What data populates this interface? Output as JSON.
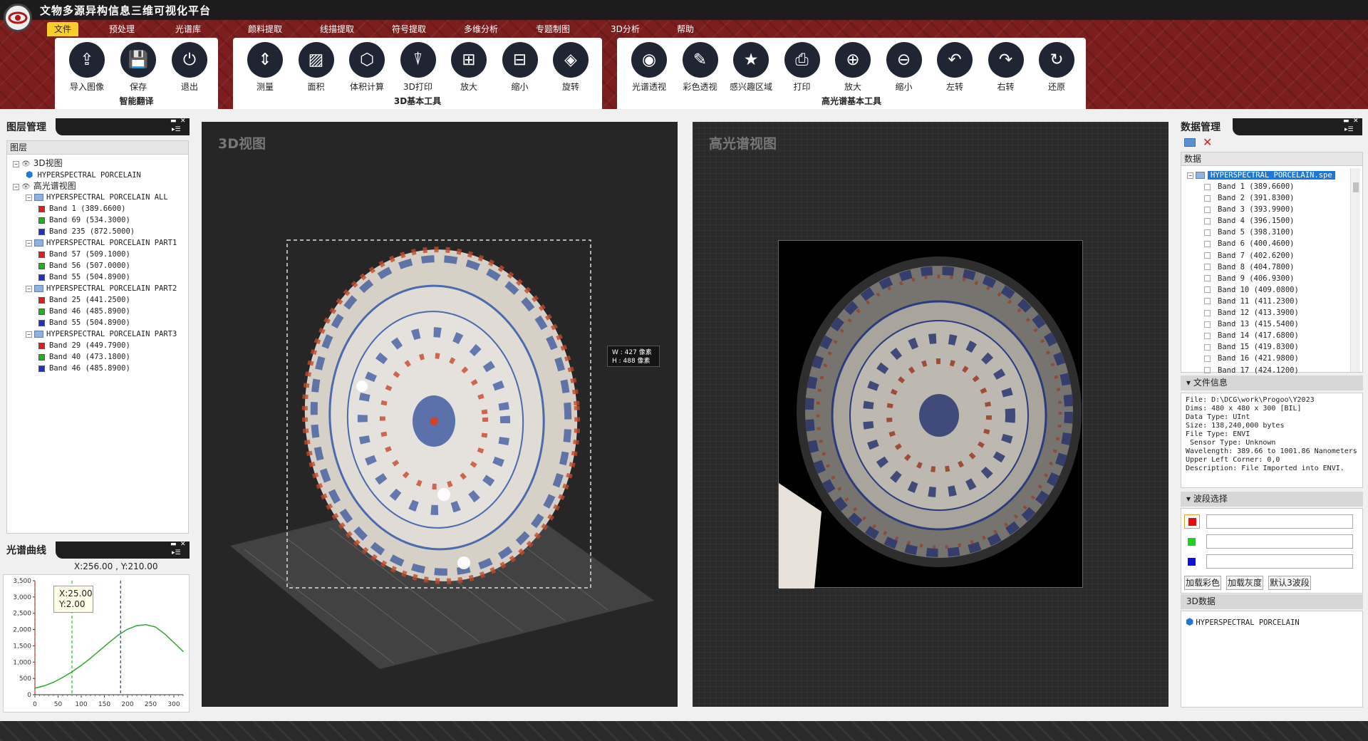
{
  "app": {
    "title": "文物多源异构信息三维可视化平台"
  },
  "tabs": [
    "文件",
    "预处理",
    "光谱库",
    "颜料提取",
    "线描提取",
    "符号提取",
    "多维分析",
    "专题制图",
    "3D分析",
    "帮助"
  ],
  "groups": {
    "smart": {
      "title": "智能翻译",
      "tools": [
        {
          "label": "导入图像",
          "icon": "import-icon",
          "glyph": "⇪"
        },
        {
          "label": "保存",
          "icon": "save-icon",
          "glyph": "💾"
        },
        {
          "label": "退出",
          "icon": "power-icon",
          "glyph": "⏻"
        }
      ]
    },
    "basic3d": {
      "title": "3D基本工具",
      "tools": [
        {
          "label": "测量",
          "icon": "measure-icon",
          "glyph": "⇕"
        },
        {
          "label": "面积",
          "icon": "area-icon",
          "glyph": "▨"
        },
        {
          "label": "体积计算",
          "icon": "volume-icon",
          "glyph": "⬡"
        },
        {
          "label": "3D打印",
          "icon": "print3d-icon",
          "glyph": "⍒"
        },
        {
          "label": "放大",
          "icon": "zoom-in-icon",
          "glyph": "⊞"
        },
        {
          "label": "缩小",
          "icon": "zoom-out-icon",
          "glyph": "⊟"
        },
        {
          "label": "旋转",
          "icon": "rotate3d-icon",
          "glyph": "◈"
        }
      ]
    },
    "hyper": {
      "title": "高光谱基本工具",
      "tools": [
        {
          "label": "光谱透视",
          "icon": "spectral-icon",
          "glyph": "◉"
        },
        {
          "label": "彩色透视",
          "icon": "color-icon",
          "glyph": "✎"
        },
        {
          "label": "感兴趣区域",
          "icon": "roi-icon",
          "glyph": "★"
        },
        {
          "label": "打印",
          "icon": "printer-icon",
          "glyph": "⎙"
        },
        {
          "label": "放大",
          "icon": "zoom-in-icon",
          "glyph": "⊕"
        },
        {
          "label": "缩小",
          "icon": "zoom-out-icon",
          "glyph": "⊖"
        },
        {
          "label": "左转",
          "icon": "undo-icon",
          "glyph": "↶"
        },
        {
          "label": "右转",
          "icon": "redo-icon",
          "glyph": "↷"
        },
        {
          "label": "还原",
          "icon": "reset-icon",
          "glyph": "↻"
        }
      ]
    }
  },
  "layers": {
    "title": "图层管理",
    "header": "图层",
    "items": [
      {
        "type": "group",
        "label": "3D视图",
        "indent": 0
      },
      {
        "type": "cube",
        "label": "HYPERSPECTRAL PORCELAIN",
        "indent": 1
      },
      {
        "type": "group",
        "label": "高光谱视图",
        "indent": 0
      },
      {
        "type": "file",
        "label": "HYPERSPECTRAL PORCELAIN ALL",
        "indent": 1
      },
      {
        "type": "band",
        "color": "r",
        "label": "Band 1 (389.6600)",
        "indent": 2
      },
      {
        "type": "band",
        "color": "g",
        "label": "Band 69 (534.3000)",
        "indent": 2
      },
      {
        "type": "band",
        "color": "b",
        "label": "Band 235 (872.5000)",
        "indent": 2
      },
      {
        "type": "file",
        "label": "HYPERSPECTRAL PORCELAIN PART1",
        "indent": 1
      },
      {
        "type": "band",
        "color": "r",
        "label": "Band 57 (509.1000)",
        "indent": 2
      },
      {
        "type": "band",
        "color": "g",
        "label": "Band 56 (507.0000)",
        "indent": 2
      },
      {
        "type": "band",
        "color": "b",
        "label": "Band 55 (504.8900)",
        "indent": 2
      },
      {
        "type": "file",
        "label": "HYPERSPECTRAL PORCELAIN PART2",
        "indent": 1
      },
      {
        "type": "band",
        "color": "r",
        "label": "Band 25 (441.2500)",
        "indent": 2
      },
      {
        "type": "band",
        "color": "g",
        "label": "Band 46 (485.8900)",
        "indent": 2
      },
      {
        "type": "band",
        "color": "b",
        "label": "Band 55 (504.8900)",
        "indent": 2
      },
      {
        "type": "file",
        "label": "HYPERSPECTRAL PORCELAIN PART3",
        "indent": 1
      },
      {
        "type": "band",
        "color": "r",
        "label": "Band 29 (449.7900)",
        "indent": 2
      },
      {
        "type": "band",
        "color": "g",
        "label": "Band 40 (473.1800)",
        "indent": 2
      },
      {
        "type": "band",
        "color": "b",
        "label": "Band 46 (485.8900)",
        "indent": 2
      }
    ]
  },
  "spectrum": {
    "title": "光谱曲线",
    "coord": "X:256.00 , Y:210.00",
    "tooltip_x": "X:25.00",
    "tooltip_y": "Y:2.00"
  },
  "chart_data": {
    "type": "line",
    "x": [
      0,
      20,
      40,
      60,
      80,
      100,
      120,
      140,
      160,
      180,
      200,
      220,
      240,
      260,
      280,
      300,
      320
    ],
    "values": [
      200,
      270,
      380,
      530,
      700,
      900,
      1120,
      1360,
      1600,
      1830,
      2010,
      2120,
      2150,
      2080,
      1870,
      1600,
      1330
    ],
    "xlim": [
      0,
      320
    ],
    "ylim": [
      0,
      3500
    ],
    "xticks": [
      "0",
      "50",
      "100",
      "150",
      "200",
      "250",
      "300"
    ],
    "yticks": [
      "0",
      "500",
      "1,000",
      "1,500",
      "2,000",
      "2,500",
      "3,000",
      "3,500"
    ],
    "markers": [
      {
        "x": 0,
        "color": "#e03030"
      },
      {
        "x": 80,
        "color": "#20c020"
      },
      {
        "x": 185,
        "color": "#3030d0"
      }
    ],
    "line_color": "#2ea82e"
  },
  "view3d": {
    "title": "3D视图",
    "w_label": "W : 427 像素",
    "h_label": "H : 488 像素"
  },
  "viewhs": {
    "title": "高光谱视图"
  },
  "data": {
    "title": "数据管理",
    "header": "数据",
    "file": "HYPERSPECTRAL PORCELAIN.spe",
    "bands": [
      "Band 1 (389.6600)",
      "Band 2 (391.8300)",
      "Band 3 (393.9900)",
      "Band 4 (396.1500)",
      "Band 5 (398.3100)",
      "Band 6 (400.4600)",
      "Band 7 (402.6200)",
      "Band 8 (404.7800)",
      "Band 9 (406.9300)",
      "Band 10 (409.0800)",
      "Band 11 (411.2300)",
      "Band 12 (413.3900)",
      "Band 13 (415.5400)",
      "Band 14 (417.6800)",
      "Band 15 (419.8300)",
      "Band 16 (421.9800)",
      "Band 17 (424.1200)"
    ],
    "fileinfo_title": "文件信息",
    "fileinfo": [
      "File: D:\\DCG\\work\\Progoo\\Y2023",
      "Dims: 480 x 480 x 300 [BIL]",
      "Data Type: UInt",
      "Size: 138,240,000 bytes",
      "File Type: ENVI",
      " Sensor Type: Unknown",
      "Wavelength: 389.66 to 1001.86 Nanometers",
      "Upper Left Corner: 0,0",
      "Description: File Imported into ENVI."
    ],
    "band_select_title": "波段选择",
    "buttons": [
      "加载彩色",
      "加载灰度",
      "默认3波段"
    ],
    "data3d_title": "3D数据",
    "data3d_item": "HYPERSPECTRAL PORCELAIN"
  },
  "colors": {
    "accent": "#f6cf2d",
    "ribbon": "#7d1e1e",
    "dark": "#1c1c1c"
  }
}
